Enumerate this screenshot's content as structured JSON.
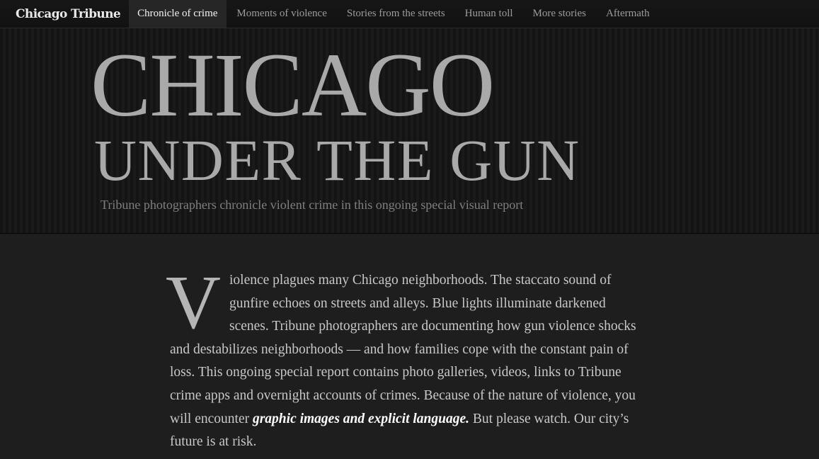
{
  "nav": {
    "logo": "Chicago Tribune",
    "items": [
      {
        "label": "Chronicle of crime",
        "active": true
      },
      {
        "label": "Moments of violence",
        "active": false
      },
      {
        "label": "Stories from the streets",
        "active": false
      },
      {
        "label": "Human toll",
        "active": false
      },
      {
        "label": "More stories",
        "active": false
      },
      {
        "label": "Aftermath",
        "active": false
      }
    ]
  },
  "hero": {
    "title_line1": "CHICAGO",
    "title_line2": "UNDER THE GUN",
    "subtitle": "Tribune photographers chronicle violent crime in this ongoing special visual report"
  },
  "article": {
    "dropcap": "V",
    "text_before_emphasis": "iolence plagues many Chicago neighborhoods. The staccato sound of gunfire echoes on streets and alleys. Blue lights illuminate darkened scenes. Tribune photographers are documenting how gun violence shocks and destabilizes neighborhoods — and how families cope with the constant pain of loss. This ongoing special report contains photo galleries, videos, links to Tribune crime apps and overnight accounts of crimes. Because of the nature of violence, you will encounter ",
    "emphasis": "graphic images and explicit language.",
    "text_after_emphasis": " But please watch. Our city’s future is at risk."
  },
  "colors": {
    "background": "#1c1c1c",
    "nav_active_bg": "#262626",
    "title_color": "#a9a9a9",
    "body_text": "#c8c8c8"
  }
}
